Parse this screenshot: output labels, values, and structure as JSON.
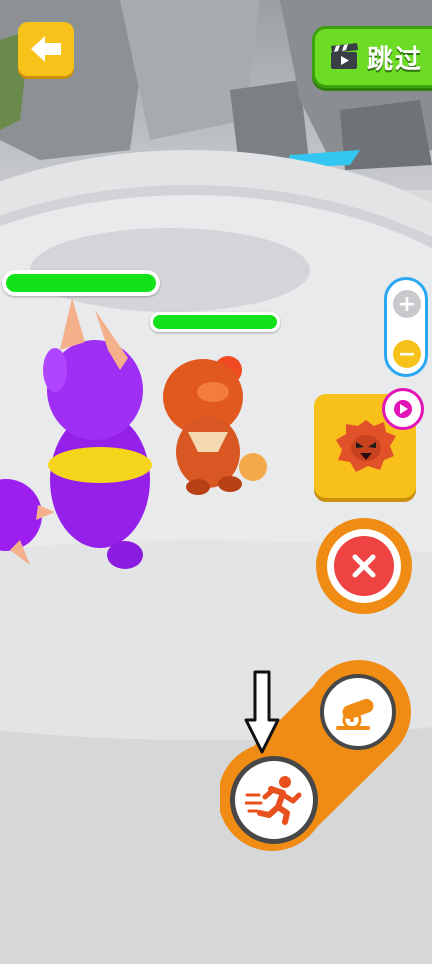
{
  "hud": {
    "skip_label": "跳过"
  },
  "health": {
    "enemy_fraction": 1.0,
    "ally_fraction": 1.0
  },
  "colors": {
    "accent_yellow": "#f7c21a",
    "skip_green": "#6cdc25",
    "health_green": "#11e21a",
    "action_orange": "#f08c14",
    "cancel_red": "#ef4343",
    "zoom_blue": "#2aa8f4",
    "ad_magenta": "#e214b8"
  },
  "icons": {
    "back": "arrow-left-icon",
    "skip": "clapperboard-icon",
    "zoom_in": "plus-icon",
    "zoom_out": "minus-icon",
    "ad": "play-icon",
    "card": "lion-monster-icon",
    "cancel": "close-icon",
    "attack": "cannon-icon",
    "run": "running-man-icon",
    "hint": "down-arrow-icon"
  }
}
